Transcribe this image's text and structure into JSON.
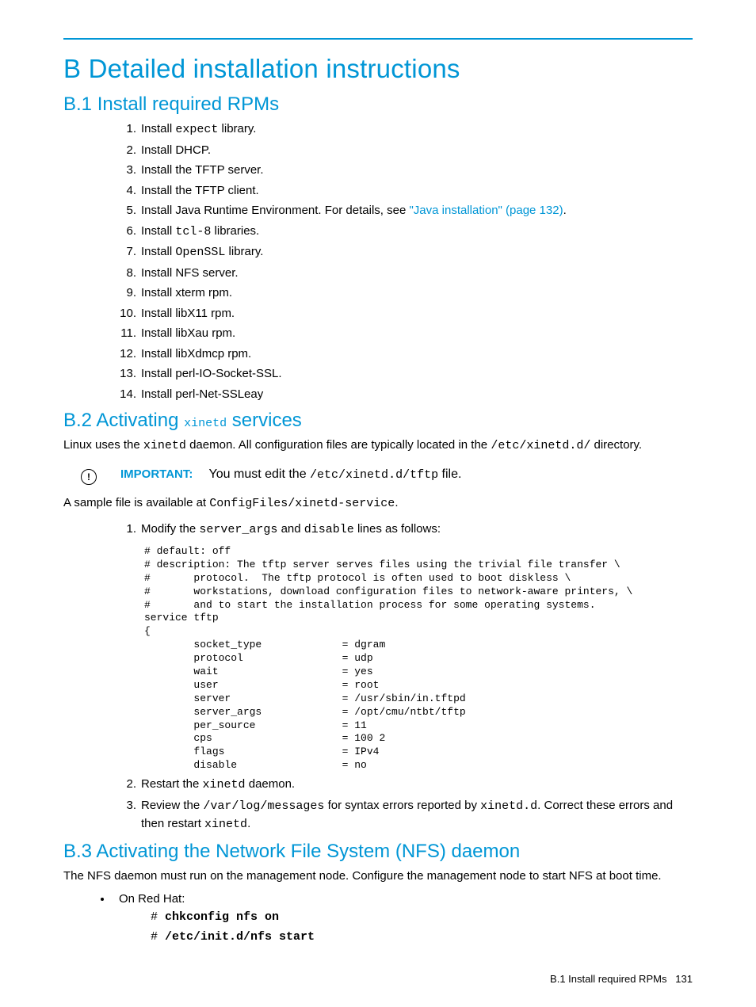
{
  "title": "B Detailed installation instructions",
  "sections": {
    "b1": {
      "heading": "B.1 Install required RPMs",
      "items": [
        {
          "pre": "Install ",
          "mono": "expect",
          "post": " library."
        },
        {
          "pre": "Install DHCP."
        },
        {
          "pre": "Install the TFTP server."
        },
        {
          "pre": "Install the TFTP client."
        },
        {
          "pre": "Install Java Runtime Environment. For details, see ",
          "link": "\"Java installation\" (page 132)",
          "post2": "."
        },
        {
          "pre": "Install ",
          "mono": "tcl-8",
          "post": " libraries."
        },
        {
          "pre": "Install ",
          "mono": "OpenSSL",
          "post": " library."
        },
        {
          "pre": "Install NFS server."
        },
        {
          "pre": "Install xterm rpm."
        },
        {
          "pre": "Install libX11 rpm."
        },
        {
          "pre": "Install libXau rpm."
        },
        {
          "pre": "Install libXdmcp rpm."
        },
        {
          "pre": "Install perl-IO-Socket-SSL."
        },
        {
          "pre": "Install perl-Net-SSLeay"
        }
      ]
    },
    "b2": {
      "heading_pre": "B.2 Activating ",
      "heading_mono": "xinetd",
      "heading_post": " services",
      "intro_pre": "Linux uses the ",
      "intro_mono1": "xinetd",
      "intro_mid": " daemon. All configuration files are typically located in the ",
      "intro_mono2": "/etc/xinetd.d/",
      "intro_post": " directory.",
      "important_label": "IMPORTANT:",
      "important_pre": "You must edit the ",
      "important_mono": "/etc/xinetd.d/tftp",
      "important_post": " file.",
      "sample_pre": "A sample file is available at ",
      "sample_mono": "ConfigFiles/xinetd-service",
      "sample_post": ".",
      "step1_pre": "Modify the ",
      "step1_mono1": "server_args",
      "step1_mid": " and ",
      "step1_mono2": "disable",
      "step1_post": " lines as follows:",
      "code": "# default: off\n# description: The tftp server serves files using the trivial file transfer \\\n#       protocol.  The tftp protocol is often used to boot diskless \\\n#       workstations, download configuration files to network-aware printers, \\\n#       and to start the installation process for some operating systems.\nservice tftp\n{\n        socket_type             = dgram\n        protocol                = udp\n        wait                    = yes\n        user                    = root\n        server                  = /usr/sbin/in.tftpd\n        server_args             = /opt/cmu/ntbt/tftp\n        per_source              = 11\n        cps                     = 100 2\n        flags                   = IPv4\n        disable                 = no",
      "step2_pre": "Restart the ",
      "step2_mono": "xinetd",
      "step2_post": " daemon.",
      "step3_pre": "Review the ",
      "step3_mono1": "/var/log/messages",
      "step3_mid": " for syntax errors reported by ",
      "step3_mono2": "xinetd.d",
      "step3_mid2": ". Correct these errors and then restart ",
      "step3_mono3": "xinetd",
      "step3_post": "."
    },
    "b3": {
      "heading": "B.3 Activating the Network File System (NFS) daemon",
      "intro": "The NFS daemon must run on the management node. Configure the management node to start NFS at boot time.",
      "bullet": "On Red Hat:",
      "cmd1_prompt": "# ",
      "cmd1": "chkconfig nfs on",
      "cmd2_prompt": "# ",
      "cmd2": "/etc/init.d/nfs start"
    }
  },
  "footer_text": "B.1 Install required RPMs",
  "footer_page": "131"
}
